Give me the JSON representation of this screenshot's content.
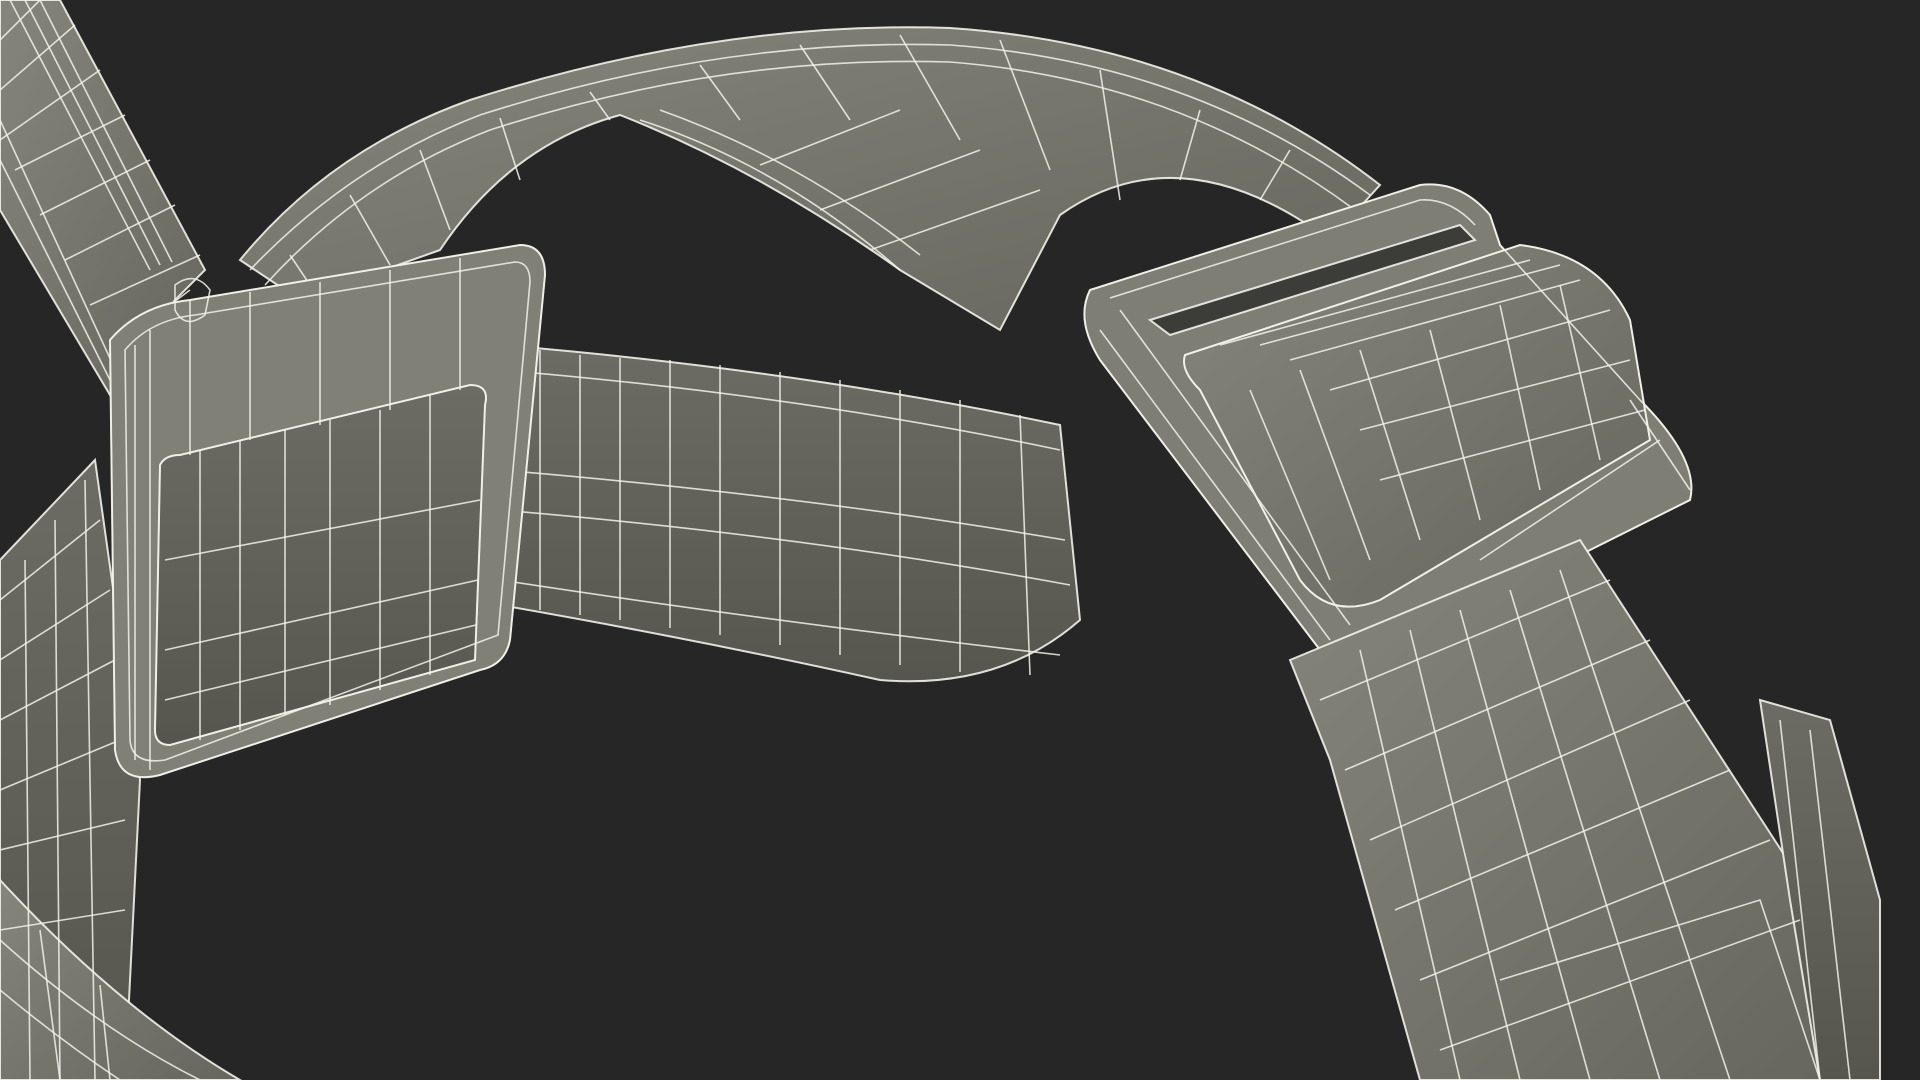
{
  "scene": {
    "subject": "wireframe-strap-headset-render",
    "background_color": "#262626",
    "surface_color": "#7a7a70",
    "surface_shadow_color": "#5f5f58",
    "surface_highlight_color": "#8a8a80",
    "wire_color": "#f2f2ea"
  }
}
